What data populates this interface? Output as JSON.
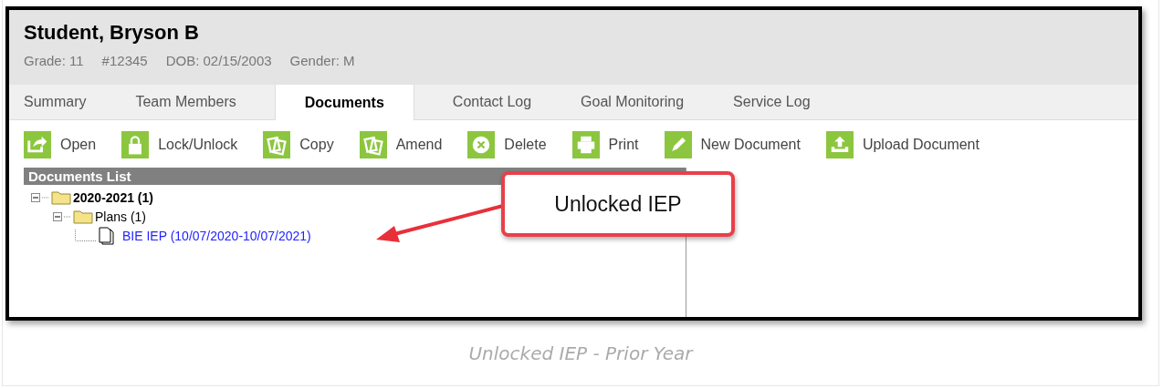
{
  "student": {
    "name": "Student, Bryson B",
    "info": [
      "Grade: 11",
      "#12345",
      "DOB: 02/15/2003",
      "Gender: M"
    ]
  },
  "tabs": [
    {
      "label": "Summary",
      "selected": false
    },
    {
      "label": "Team Members",
      "selected": false
    },
    {
      "label": "Documents",
      "selected": true
    },
    {
      "label": "Contact Log",
      "selected": false
    },
    {
      "label": "Goal Monitoring",
      "selected": false
    },
    {
      "label": "Service Log",
      "selected": false
    }
  ],
  "toolbar": [
    {
      "label": "Open",
      "kind": "open"
    },
    {
      "label": "Lock/Unlock",
      "kind": "lock"
    },
    {
      "label": "Copy",
      "kind": "copy"
    },
    {
      "label": "Amend",
      "kind": "copy"
    },
    {
      "label": "Delete",
      "kind": "delete"
    },
    {
      "label": "Print",
      "kind": "print"
    },
    {
      "label": "New Document",
      "kind": "pencil"
    },
    {
      "label": "Upload Document",
      "kind": "upload"
    }
  ],
  "documents_list": {
    "title": "Documents List",
    "tree": [
      {
        "label": "2020-2021 (1)",
        "kind": "folder",
        "expanded": true,
        "children": [
          {
            "label": "Plans (1)",
            "kind": "folder",
            "expanded": true,
            "children": [
              {
                "label": "BIE IEP (10/07/2020-10/07/2021)",
                "kind": "document"
              }
            ]
          }
        ]
      }
    ]
  },
  "callout": {
    "text": "Unlocked IEP"
  },
  "caption": "Unlocked IEP - Prior Year"
}
